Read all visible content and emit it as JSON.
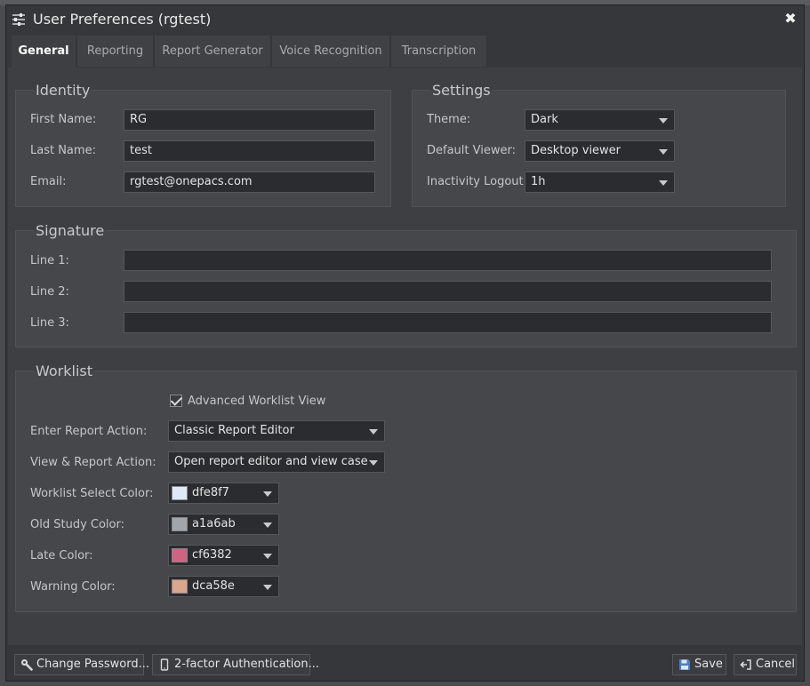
{
  "window": {
    "title": "User Preferences (rgtest)"
  },
  "tabs": [
    {
      "label": "General",
      "active": true
    },
    {
      "label": "Reporting",
      "active": false
    },
    {
      "label": "Report Generator",
      "active": false
    },
    {
      "label": "Voice Recognition",
      "active": false
    },
    {
      "label": "Transcription",
      "active": false
    }
  ],
  "identity": {
    "legend": "Identity",
    "first_name_label": "First Name:",
    "first_name": "RG",
    "last_name_label": "Last Name:",
    "last_name": "test",
    "email_label": "Email:",
    "email": "rgtest@onepacs.com"
  },
  "settings": {
    "legend": "Settings",
    "theme_label": "Theme:",
    "theme": "Dark",
    "viewer_label": "Default Viewer:",
    "viewer": "Desktop viewer",
    "logout_label": "Inactivity Logout:",
    "logout": "1h"
  },
  "signature": {
    "legend": "Signature",
    "line1_label": "Line 1:",
    "line1": "",
    "line2_label": "Line 2:",
    "line2": "",
    "line3_label": "Line 3:",
    "line3": ""
  },
  "worklist": {
    "legend": "Worklist",
    "advanced_label": "Advanced Worklist View",
    "advanced_checked": true,
    "enter_action_label": "Enter Report Action:",
    "enter_action": "Classic Report Editor",
    "view_action_label": "View & Report Action:",
    "view_action": "Open report editor and view case",
    "colors": [
      {
        "label": "Worklist Select Color:",
        "value": "dfe8f7",
        "hex": "#dfe8f7"
      },
      {
        "label": "Old Study Color:",
        "value": "a1a6ab",
        "hex": "#a1a6ab"
      },
      {
        "label": "Late Color:",
        "value": "cf6382",
        "hex": "#cf6382"
      },
      {
        "label": "Warning Color:",
        "value": "dca58e",
        "hex": "#dca58e"
      }
    ]
  },
  "footer": {
    "change_password": "Change Password...",
    "two_factor": "2-factor Authentication...",
    "save": "Save",
    "cancel": "Cancel"
  }
}
